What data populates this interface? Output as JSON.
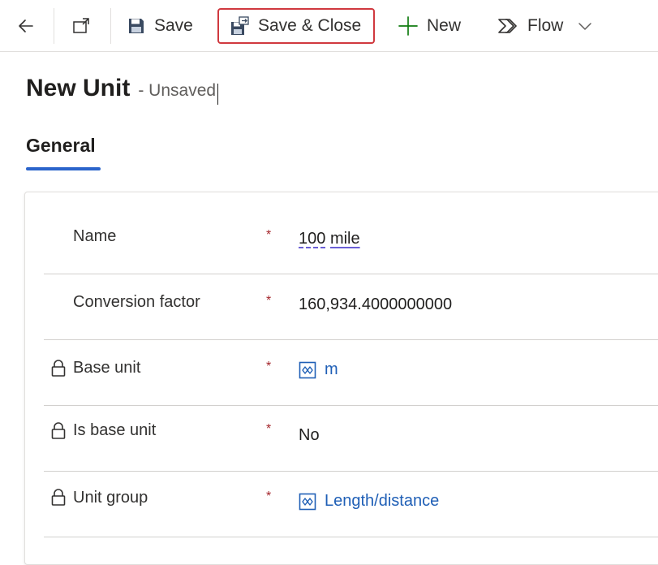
{
  "commandbar": {
    "save_label": "Save",
    "save_close_label": "Save & Close",
    "new_label": "New",
    "flow_label": "Flow"
  },
  "header": {
    "title": "New Unit",
    "status": "- Unsaved"
  },
  "tabs": [
    {
      "label": "General",
      "selected": true
    }
  ],
  "form": {
    "rows": [
      {
        "label": "Name",
        "value_part1": "100",
        "value_part2": "mile",
        "required": true,
        "locked": false
      },
      {
        "label": "Conversion factor",
        "value": "160,934.4000000000",
        "required": true,
        "locked": false
      },
      {
        "label": "Base unit",
        "value": "m",
        "required": true,
        "locked": true,
        "lookup": true
      },
      {
        "label": "Is base unit",
        "value": "No",
        "required": true,
        "locked": true
      },
      {
        "label": "Unit group",
        "value": "Length/distance",
        "required": true,
        "locked": true,
        "lookup": true
      }
    ],
    "required_marker": "*"
  },
  "colors": {
    "accent_blue": "#2b64cb",
    "link_blue": "#1f5fb6",
    "required_red": "#a4262c",
    "highlight_red": "#d0393f",
    "new_green": "#107c10"
  },
  "icons": {
    "back": "arrow-left-icon",
    "popout": "open-in-new-window-icon",
    "save": "floppy-disk-icon",
    "save_close": "save-and-close-icon",
    "new": "plus-icon",
    "flow": "power-automate-icon",
    "flow_menu": "chevron-down-icon",
    "lock": "lock-icon",
    "lookup": "entity-lookup-icon"
  }
}
